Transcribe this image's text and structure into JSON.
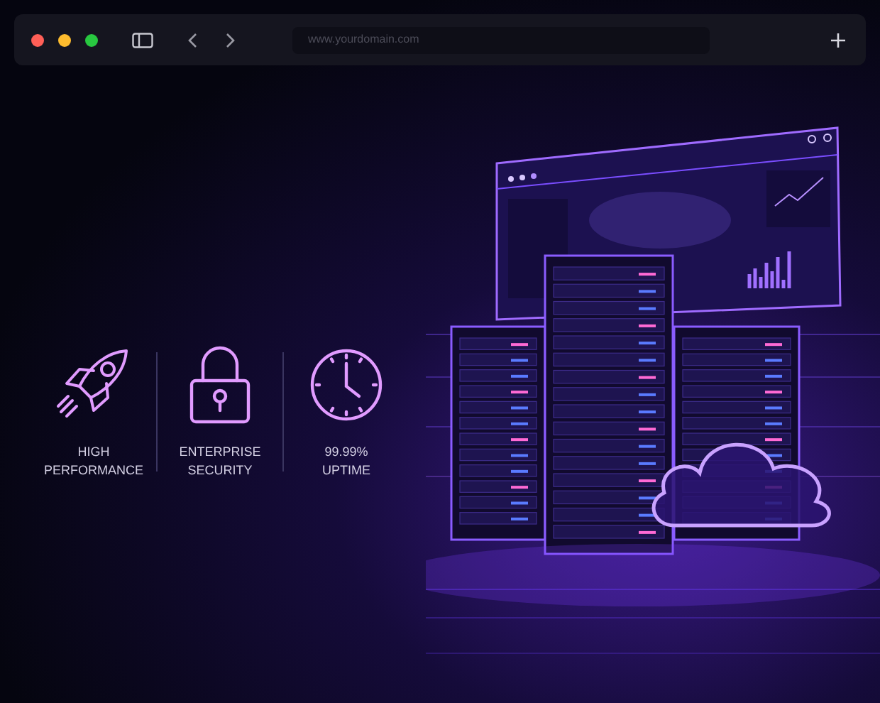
{
  "browser": {
    "address": "www.yourdomain.com"
  },
  "features": [
    {
      "kind": "performance",
      "label": "HIGH\nPERFORMANCE"
    },
    {
      "kind": "security",
      "label": "ENTERPRISE\nSECURITY"
    },
    {
      "kind": "uptime",
      "label": "99.99%\nUPTIME"
    }
  ]
}
